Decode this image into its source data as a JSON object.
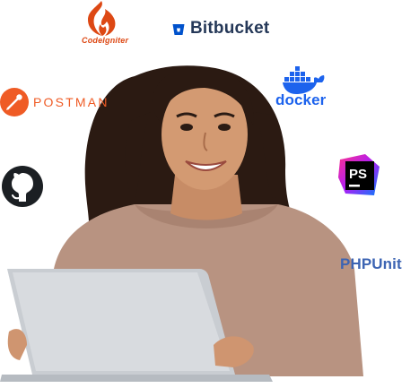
{
  "logos": {
    "codeigniter": {
      "name": "CodeIgniter",
      "color": "#dd4814",
      "icon": "codeigniter-flame-icon"
    },
    "bitbucket": {
      "name": "Bitbucket",
      "color": "#253858",
      "icon": "bitbucket-bucket-icon"
    },
    "docker": {
      "name": "docker",
      "color": "#1d63ed",
      "icon": "docker-whale-icon"
    },
    "postman": {
      "name": "POSTMAN",
      "color": "#ef5b25",
      "icon": "postman-rocket-icon"
    },
    "github": {
      "icon": "github-octocat-icon",
      "color": "#1b1f23"
    },
    "phpstorm": {
      "icon": "phpstorm-ps-icon",
      "label": "PS",
      "colors": [
        "#ff318c",
        "#af1df5",
        "#087cfa"
      ]
    },
    "phpunit": {
      "name": "PHPUnit",
      "color": "#3c64b3"
    }
  }
}
